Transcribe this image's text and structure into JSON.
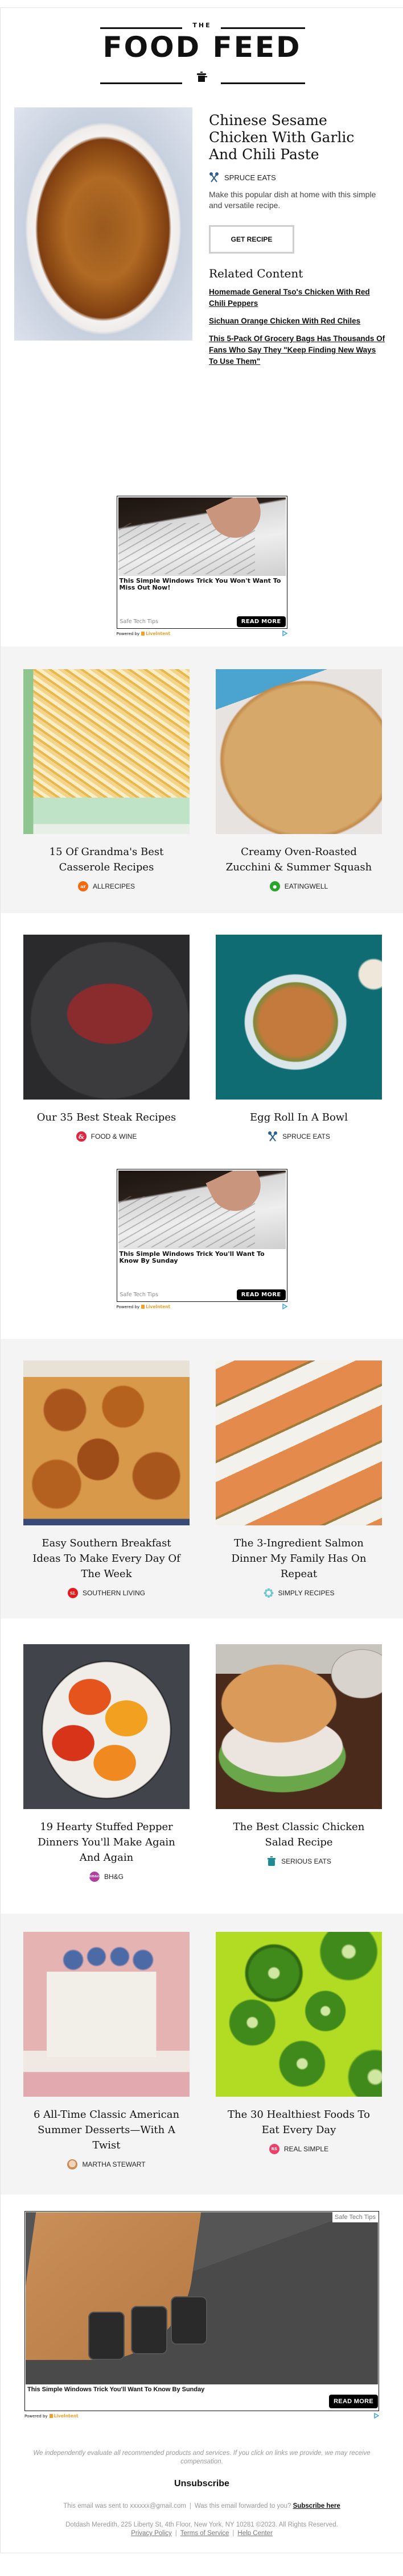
{
  "masthead": {
    "the": "THE",
    "title": "FOOD FEED",
    "icon": "cooking-pot-icon"
  },
  "hero": {
    "image_alt": "Bowl of sesame chicken",
    "title": "Chinese Sesame Chicken With Garlic And Chili Paste",
    "source": "SPRUCE EATS",
    "source_icon": "spoon-fork-icon",
    "description": "Make this popular dish at home with this simple and versatile recipe.",
    "cta_label": "GET RECIPE",
    "related_heading": "Related Content",
    "related": [
      "Homemade General Tso's Chicken With Red Chili Peppers",
      "Sichuan Orange Chicken With Red Chiles",
      "This 5-Pack Of Grocery Bags Has Thousands Of Fans Who Say They \"Keep Finding New Ways To Use Them\""
    ]
  },
  "ads": [
    {
      "headline": "This Simple Windows Trick You Won't Want To Miss Out Now!",
      "sponsor": "Safe Tech Tips",
      "cta": "READ MORE",
      "powered_by": "Powered by",
      "powered_brand": "LiveIntent"
    },
    {
      "headline": "This Simple Windows Trick You'll Want To Know By Sunday",
      "sponsor": "Safe Tech Tips",
      "cta": "READ MORE",
      "powered_by": "Powered by",
      "powered_brand": "LiveIntent"
    },
    {
      "headline": "This Simple Windows Trick You'll Want To Know By Sunday",
      "sponsor": "Safe Tech Tips",
      "cta": "READ MORE",
      "powered_by": "Powered by",
      "powered_brand": "LiveIntent"
    }
  ],
  "cards": [
    {
      "title": "15 Of Grandma's Best Casserole Recipes",
      "source": "ALLRECIPES",
      "icon": "allrecipes-logo-icon",
      "badge": "ar",
      "color": "#f26a10"
    },
    {
      "title": "Creamy Oven-Roasted Zucchini & Summer Squash",
      "source": "EATINGWELL",
      "icon": "eatingwell-apple-icon",
      "badge": "",
      "color": "#2aa52a"
    },
    {
      "title": "Our 35 Best Steak Recipes",
      "source": "FOOD & WINE",
      "icon": "food-and-wine-ampersand-icon",
      "badge": "&",
      "color": "#e0263f"
    },
    {
      "title": "Egg Roll In A Bowl",
      "source": "SPRUCE EATS",
      "icon": "spoon-fork-icon",
      "badge": "",
      "color": "#2d5f8f"
    },
    {
      "title": "Easy Southern Breakfast Ideas To Make Every Day Of The Week",
      "source": "SOUTHERN LIVING",
      "icon": "southern-living-logo-icon",
      "badge": "SL",
      "color": "#e21b1b"
    },
    {
      "title": "The 3-Ingredient Salmon Dinner My Family Has On Repeat",
      "source": "SIMPLY RECIPES",
      "icon": "simply-recipes-flower-icon",
      "badge": "",
      "color": "#6fc6cc"
    },
    {
      "title": "19 Hearty Stuffed Pepper Dinners You'll Make Again And Again",
      "source": "BH&G",
      "icon": "bhg-logo-icon",
      "badge": "BH&G",
      "color": "#b040a0"
    },
    {
      "title": "The Best Classic Chicken Salad Recipe",
      "source": "SERIOUS EATS",
      "icon": "serious-eats-pot-icon",
      "badge": "",
      "color": "#1e8a95"
    },
    {
      "title": "6 All-Time Classic American Summer Desserts—With A Twist",
      "source": "MARTHA STEWART",
      "icon": "martha-stewart-avatar-icon",
      "badge": "",
      "color": "#d9a27a"
    },
    {
      "title": "The 30 Healthiest Foods To Eat Every Day",
      "source": "REAL SIMPLE",
      "icon": "real-simple-logo-icon",
      "badge": "RS",
      "color": "#ec3f6a"
    }
  ],
  "footer": {
    "disclaimer": "We independently evaluate all recommended products and services. If you click on links we provide, we may receive compensation.",
    "unsubscribe": "Unsubscribe",
    "sent_to": "This email was sent to xxxxxx@gmail.com",
    "forwarded": "Was this email forwarded to you?",
    "subscribe_link": "Subscribe here",
    "address": "Dotdash Meredith, 225 Liberty St, 4th Floor, New York, NY 10281 ©2023. All Rights Reserved.",
    "links": [
      "Privacy Policy",
      "Terms of Service",
      "Help Center"
    ]
  }
}
